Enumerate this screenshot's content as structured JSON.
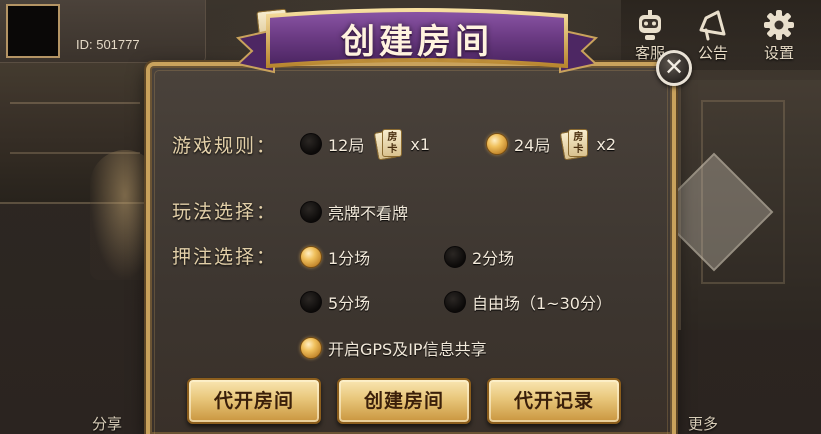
{
  "profile": {
    "id_text": "ID: 501777"
  },
  "top_buttons": {
    "customer_service": "客服",
    "announcement": "公告",
    "settings": "设置"
  },
  "bottom": {
    "share": "分享",
    "more": "更多"
  },
  "dialog": {
    "title": "创建房间",
    "room_card_tab": "房",
    "close_symbol": "✕",
    "rules": {
      "label": "游戏规则：",
      "options": [
        {
          "text": "12局",
          "card": "房卡",
          "multiplier": "x1",
          "selected": false
        },
        {
          "text": "24局",
          "card": "房卡",
          "multiplier": "x2",
          "selected": true
        }
      ]
    },
    "play": {
      "label": "玩法选择：",
      "option": {
        "text": "亮牌不看牌",
        "selected": false
      }
    },
    "bet": {
      "label": "押注选择：",
      "options": [
        {
          "text": "1分场",
          "selected": true
        },
        {
          "text": "2分场",
          "selected": false
        },
        {
          "text": "5分场",
          "selected": false
        },
        {
          "text": "自由场（1~30分）",
          "selected": false
        }
      ]
    },
    "gps": {
      "text": "开启GPS及IP信息共享",
      "selected": true
    },
    "buttons": {
      "proxy_open": "代开房间",
      "create": "创建房间",
      "proxy_records": "代开记录"
    }
  },
  "colors": {
    "gold_border": "#c9a25c",
    "banner_purple": "#6a3a82",
    "label_gold": "#e2cfa8"
  }
}
